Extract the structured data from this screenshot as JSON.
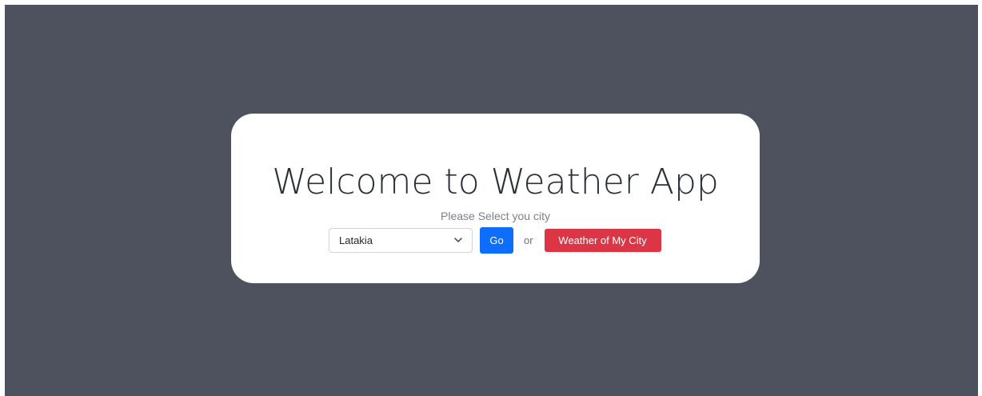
{
  "page": {
    "background_color": "#4d525e"
  },
  "card": {
    "title": "Welcome to Weather App",
    "subtitle": "Please Select you city",
    "city_select": {
      "selected_value": "Latakia",
      "icon": "chevron-down-icon"
    },
    "go_button": {
      "label": "Go",
      "color": "#0d6efd"
    },
    "separator_text": "or",
    "my_city_button": {
      "label": "Weather of My City",
      "color": "#dc3545"
    }
  }
}
